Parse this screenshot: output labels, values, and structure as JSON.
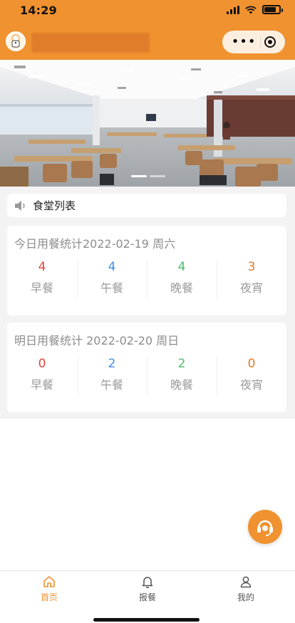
{
  "status": {
    "time": "14:29"
  },
  "header": {
    "title_obscured": true,
    "capsule": {
      "more_icon": "dots-icon",
      "close_icon": "target-icon"
    }
  },
  "banner": {
    "slides": 3,
    "active_slide": 0
  },
  "canteen_list": {
    "label": "食堂列表"
  },
  "today": {
    "title": "今日用餐统计2022-02-19 周六",
    "items": [
      {
        "value": "4",
        "label": "早餐",
        "color": "#e0463a"
      },
      {
        "value": "4",
        "label": "午餐",
        "color": "#3d8ee8"
      },
      {
        "value": "4",
        "label": "晚餐",
        "color": "#4dbb6b"
      },
      {
        "value": "3",
        "label": "夜宵",
        "color": "#e07b2a"
      }
    ]
  },
  "tomorrow": {
    "title": "明日用餐统计 2022-02-20 周日",
    "items": [
      {
        "value": "0",
        "label": "早餐",
        "color": "#e0463a"
      },
      {
        "value": "2",
        "label": "午餐",
        "color": "#3d8ee8"
      },
      {
        "value": "2",
        "label": "晚餐",
        "color": "#4dbb6b"
      },
      {
        "value": "0",
        "label": "夜宵",
        "color": "#e07b2a"
      }
    ]
  },
  "tabbar": {
    "tabs": [
      {
        "label": "首页",
        "icon": "home-icon",
        "active": true
      },
      {
        "label": "报餐",
        "icon": "bell-icon",
        "active": false
      },
      {
        "label": "我的",
        "icon": "user-icon",
        "active": false
      }
    ]
  },
  "colors": {
    "primary": "#f0922f",
    "red": "#e0463a",
    "blue": "#3d8ee8",
    "green": "#4dbb6b",
    "orange": "#e07b2a"
  }
}
